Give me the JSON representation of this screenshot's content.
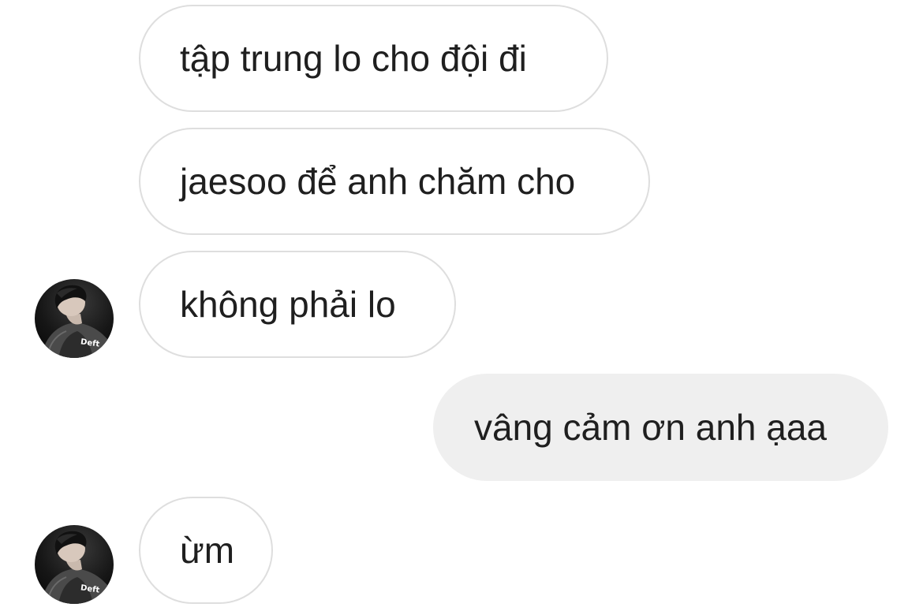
{
  "chat": {
    "messages": [
      {
        "direction": "incoming",
        "text": "tập trung lo cho đội đi",
        "show_avatar": false
      },
      {
        "direction": "incoming",
        "text": "jaesoo để anh chăm cho",
        "show_avatar": false
      },
      {
        "direction": "incoming",
        "text": "không phải lo",
        "show_avatar": true
      },
      {
        "direction": "outgoing",
        "text": "vâng cảm ơn anh ạaa",
        "show_avatar": false
      },
      {
        "direction": "incoming",
        "text": "ừm",
        "show_avatar": true
      }
    ],
    "contact": {
      "avatar_icon": "profile-photo",
      "avatar_caption": "Deft"
    },
    "colors": {
      "incoming_bubble_bg": "#ffffff",
      "incoming_bubble_border": "#dedede",
      "outgoing_bubble_bg": "#efefef",
      "text": "#1f1f1f",
      "background": "#ffffff"
    }
  }
}
